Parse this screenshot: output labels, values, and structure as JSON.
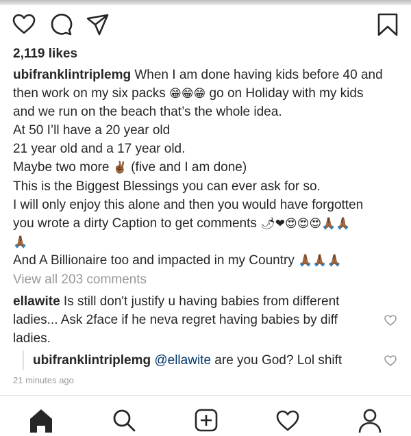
{
  "post": {
    "likes": "2,119 likes",
    "caption": {
      "username": "ubifranklintriplemg",
      "lines": [
        " When I am done having kids before 40 and",
        "then work on my six packs ",
        "and we run on the beach that’s the whole idea.",
        "At 50 I’ll have a 20 year old",
        "21 year old and a 17 year old.",
        "Maybe two more ",
        "This is the Biggest Blessings you can ever ask for so.",
        "I will only enjoy this alone and then you would have forgotten",
        "you wrote a dirty Caption to get comments ",
        "",
        "And A Billionaire too and impacted in my Country "
      ],
      "line2_after": " go on Holiday with my kids",
      "line6_after": " (five and I am done)",
      "emoji_laugh": "😁😁😁",
      "emoji_peace": "✌🏾",
      "emoji_comments": "🌶❤😍😍😍🙏🏾🙏🏾",
      "emoji_pray_one": "🙏🏾",
      "emoji_pray_three": "🙏🏾🙏🏾🙏🏾"
    },
    "view_all_comments": "View all 203 comments",
    "comment": {
      "username": "ellawite",
      "lines": [
        " Is still don't justify u having babies from different",
        "ladies... Ask 2face if he neva regret having babies by diff",
        "ladies."
      ]
    },
    "reply": {
      "username": "ubifranklintriplemg",
      "mention": "@ellawite",
      "text": " are you God? Lol shift"
    },
    "timestamp": "21 minutes ago"
  },
  "icons": {
    "like": "heart-icon",
    "comment": "comment-bubble-icon",
    "share": "paper-plane-icon",
    "save": "bookmark-icon",
    "home": "home-icon",
    "search": "search-icon",
    "new_post": "add-post-icon",
    "activity": "activity-heart-icon",
    "profile": "profile-icon"
  },
  "colors": {
    "text": "#262626",
    "muted": "#999999",
    "mention": "#003569",
    "divider": "#dbdbdb"
  }
}
